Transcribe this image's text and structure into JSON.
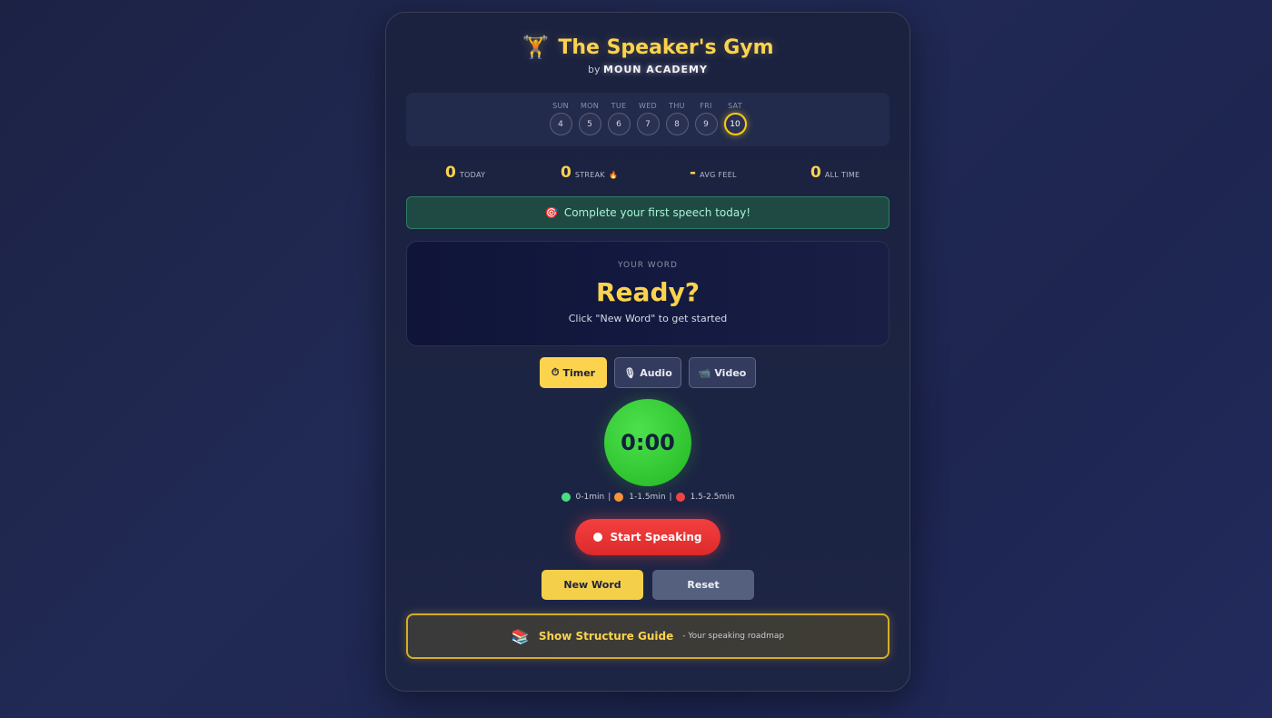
{
  "header": {
    "title_icon": "weightlifter-icon",
    "title": "The Speaker's Gym",
    "by_prefix": "by",
    "brand": "MOUN ACADEMY"
  },
  "week": {
    "days": [
      {
        "label": "SUN",
        "date": "4"
      },
      {
        "label": "MON",
        "date": "5"
      },
      {
        "label": "TUE",
        "date": "6"
      },
      {
        "label": "WED",
        "date": "7"
      },
      {
        "label": "THU",
        "date": "8"
      },
      {
        "label": "FRI",
        "date": "9"
      },
      {
        "label": "SAT",
        "date": "10",
        "today": true
      }
    ]
  },
  "stats": {
    "today": {
      "value": "0",
      "label": "TODAY"
    },
    "streak": {
      "value": "0",
      "label": "STREAK"
    },
    "avg_feel": {
      "value": "-",
      "label": "AVG FEEL"
    },
    "all_time": {
      "value": "0",
      "label": "ALL TIME"
    }
  },
  "banner": {
    "icon": "target-icon",
    "text": "Complete your first speech today!"
  },
  "word": {
    "label": "YOUR WORD",
    "value": "Ready?",
    "hint": "Click \"New Word\" to get started"
  },
  "modes": [
    {
      "label": "Timer",
      "icon": "stopwatch-icon",
      "active": true
    },
    {
      "label": "Audio",
      "icon": "microphone-icon",
      "active": false
    },
    {
      "label": "Video",
      "icon": "camera-icon",
      "active": false
    }
  ],
  "timer": {
    "display": "0:00"
  },
  "legend": [
    {
      "label": "0-1min",
      "color": "#4ade80"
    },
    {
      "label": "1-1.5min",
      "color": "#fb923c"
    },
    {
      "label": "1.5-2.5min",
      "color": "#ef4444"
    }
  ],
  "actions": {
    "start": "Start Speaking",
    "new_word": "New Word",
    "reset": "Reset"
  },
  "guide": {
    "title": "Show Structure Guide",
    "subtitle": "- Your speaking roadmap"
  },
  "colors": {
    "accent": "#fcd34d",
    "success": "#2fc42f",
    "danger": "#ef4444"
  }
}
